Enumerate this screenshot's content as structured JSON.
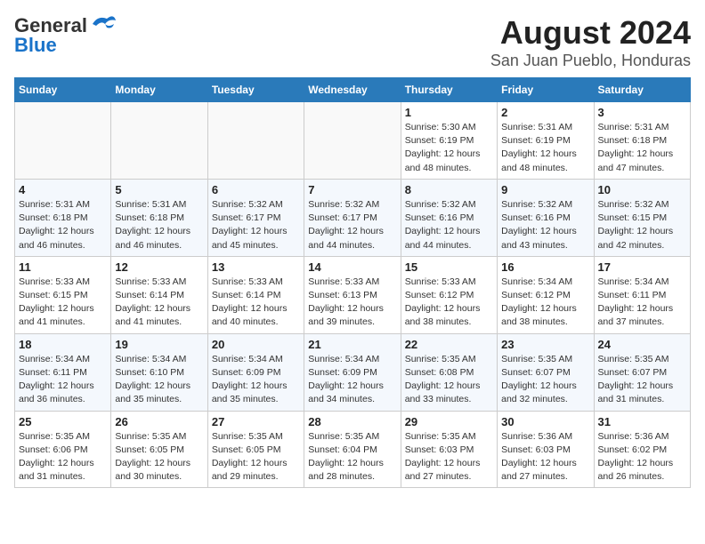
{
  "header": {
    "logo_line1": "General",
    "logo_line2": "Blue",
    "title": "August 2024",
    "subtitle": "San Juan Pueblo, Honduras"
  },
  "weekdays": [
    "Sunday",
    "Monday",
    "Tuesday",
    "Wednesday",
    "Thursday",
    "Friday",
    "Saturday"
  ],
  "weeks": [
    [
      {
        "day": "",
        "info": ""
      },
      {
        "day": "",
        "info": ""
      },
      {
        "day": "",
        "info": ""
      },
      {
        "day": "",
        "info": ""
      },
      {
        "day": "1",
        "info": "Sunrise: 5:30 AM\nSunset: 6:19 PM\nDaylight: 12 hours\nand 48 minutes."
      },
      {
        "day": "2",
        "info": "Sunrise: 5:31 AM\nSunset: 6:19 PM\nDaylight: 12 hours\nand 48 minutes."
      },
      {
        "day": "3",
        "info": "Sunrise: 5:31 AM\nSunset: 6:18 PM\nDaylight: 12 hours\nand 47 minutes."
      }
    ],
    [
      {
        "day": "4",
        "info": "Sunrise: 5:31 AM\nSunset: 6:18 PM\nDaylight: 12 hours\nand 46 minutes."
      },
      {
        "day": "5",
        "info": "Sunrise: 5:31 AM\nSunset: 6:18 PM\nDaylight: 12 hours\nand 46 minutes."
      },
      {
        "day": "6",
        "info": "Sunrise: 5:32 AM\nSunset: 6:17 PM\nDaylight: 12 hours\nand 45 minutes."
      },
      {
        "day": "7",
        "info": "Sunrise: 5:32 AM\nSunset: 6:17 PM\nDaylight: 12 hours\nand 44 minutes."
      },
      {
        "day": "8",
        "info": "Sunrise: 5:32 AM\nSunset: 6:16 PM\nDaylight: 12 hours\nand 44 minutes."
      },
      {
        "day": "9",
        "info": "Sunrise: 5:32 AM\nSunset: 6:16 PM\nDaylight: 12 hours\nand 43 minutes."
      },
      {
        "day": "10",
        "info": "Sunrise: 5:32 AM\nSunset: 6:15 PM\nDaylight: 12 hours\nand 42 minutes."
      }
    ],
    [
      {
        "day": "11",
        "info": "Sunrise: 5:33 AM\nSunset: 6:15 PM\nDaylight: 12 hours\nand 41 minutes."
      },
      {
        "day": "12",
        "info": "Sunrise: 5:33 AM\nSunset: 6:14 PM\nDaylight: 12 hours\nand 41 minutes."
      },
      {
        "day": "13",
        "info": "Sunrise: 5:33 AM\nSunset: 6:14 PM\nDaylight: 12 hours\nand 40 minutes."
      },
      {
        "day": "14",
        "info": "Sunrise: 5:33 AM\nSunset: 6:13 PM\nDaylight: 12 hours\nand 39 minutes."
      },
      {
        "day": "15",
        "info": "Sunrise: 5:33 AM\nSunset: 6:12 PM\nDaylight: 12 hours\nand 38 minutes."
      },
      {
        "day": "16",
        "info": "Sunrise: 5:34 AM\nSunset: 6:12 PM\nDaylight: 12 hours\nand 38 minutes."
      },
      {
        "day": "17",
        "info": "Sunrise: 5:34 AM\nSunset: 6:11 PM\nDaylight: 12 hours\nand 37 minutes."
      }
    ],
    [
      {
        "day": "18",
        "info": "Sunrise: 5:34 AM\nSunset: 6:11 PM\nDaylight: 12 hours\nand 36 minutes."
      },
      {
        "day": "19",
        "info": "Sunrise: 5:34 AM\nSunset: 6:10 PM\nDaylight: 12 hours\nand 35 minutes."
      },
      {
        "day": "20",
        "info": "Sunrise: 5:34 AM\nSunset: 6:09 PM\nDaylight: 12 hours\nand 35 minutes."
      },
      {
        "day": "21",
        "info": "Sunrise: 5:34 AM\nSunset: 6:09 PM\nDaylight: 12 hours\nand 34 minutes."
      },
      {
        "day": "22",
        "info": "Sunrise: 5:35 AM\nSunset: 6:08 PM\nDaylight: 12 hours\nand 33 minutes."
      },
      {
        "day": "23",
        "info": "Sunrise: 5:35 AM\nSunset: 6:07 PM\nDaylight: 12 hours\nand 32 minutes."
      },
      {
        "day": "24",
        "info": "Sunrise: 5:35 AM\nSunset: 6:07 PM\nDaylight: 12 hours\nand 31 minutes."
      }
    ],
    [
      {
        "day": "25",
        "info": "Sunrise: 5:35 AM\nSunset: 6:06 PM\nDaylight: 12 hours\nand 31 minutes."
      },
      {
        "day": "26",
        "info": "Sunrise: 5:35 AM\nSunset: 6:05 PM\nDaylight: 12 hours\nand 30 minutes."
      },
      {
        "day": "27",
        "info": "Sunrise: 5:35 AM\nSunset: 6:05 PM\nDaylight: 12 hours\nand 29 minutes."
      },
      {
        "day": "28",
        "info": "Sunrise: 5:35 AM\nSunset: 6:04 PM\nDaylight: 12 hours\nand 28 minutes."
      },
      {
        "day": "29",
        "info": "Sunrise: 5:35 AM\nSunset: 6:03 PM\nDaylight: 12 hours\nand 27 minutes."
      },
      {
        "day": "30",
        "info": "Sunrise: 5:36 AM\nSunset: 6:03 PM\nDaylight: 12 hours\nand 27 minutes."
      },
      {
        "day": "31",
        "info": "Sunrise: 5:36 AM\nSunset: 6:02 PM\nDaylight: 12 hours\nand 26 minutes."
      }
    ]
  ]
}
